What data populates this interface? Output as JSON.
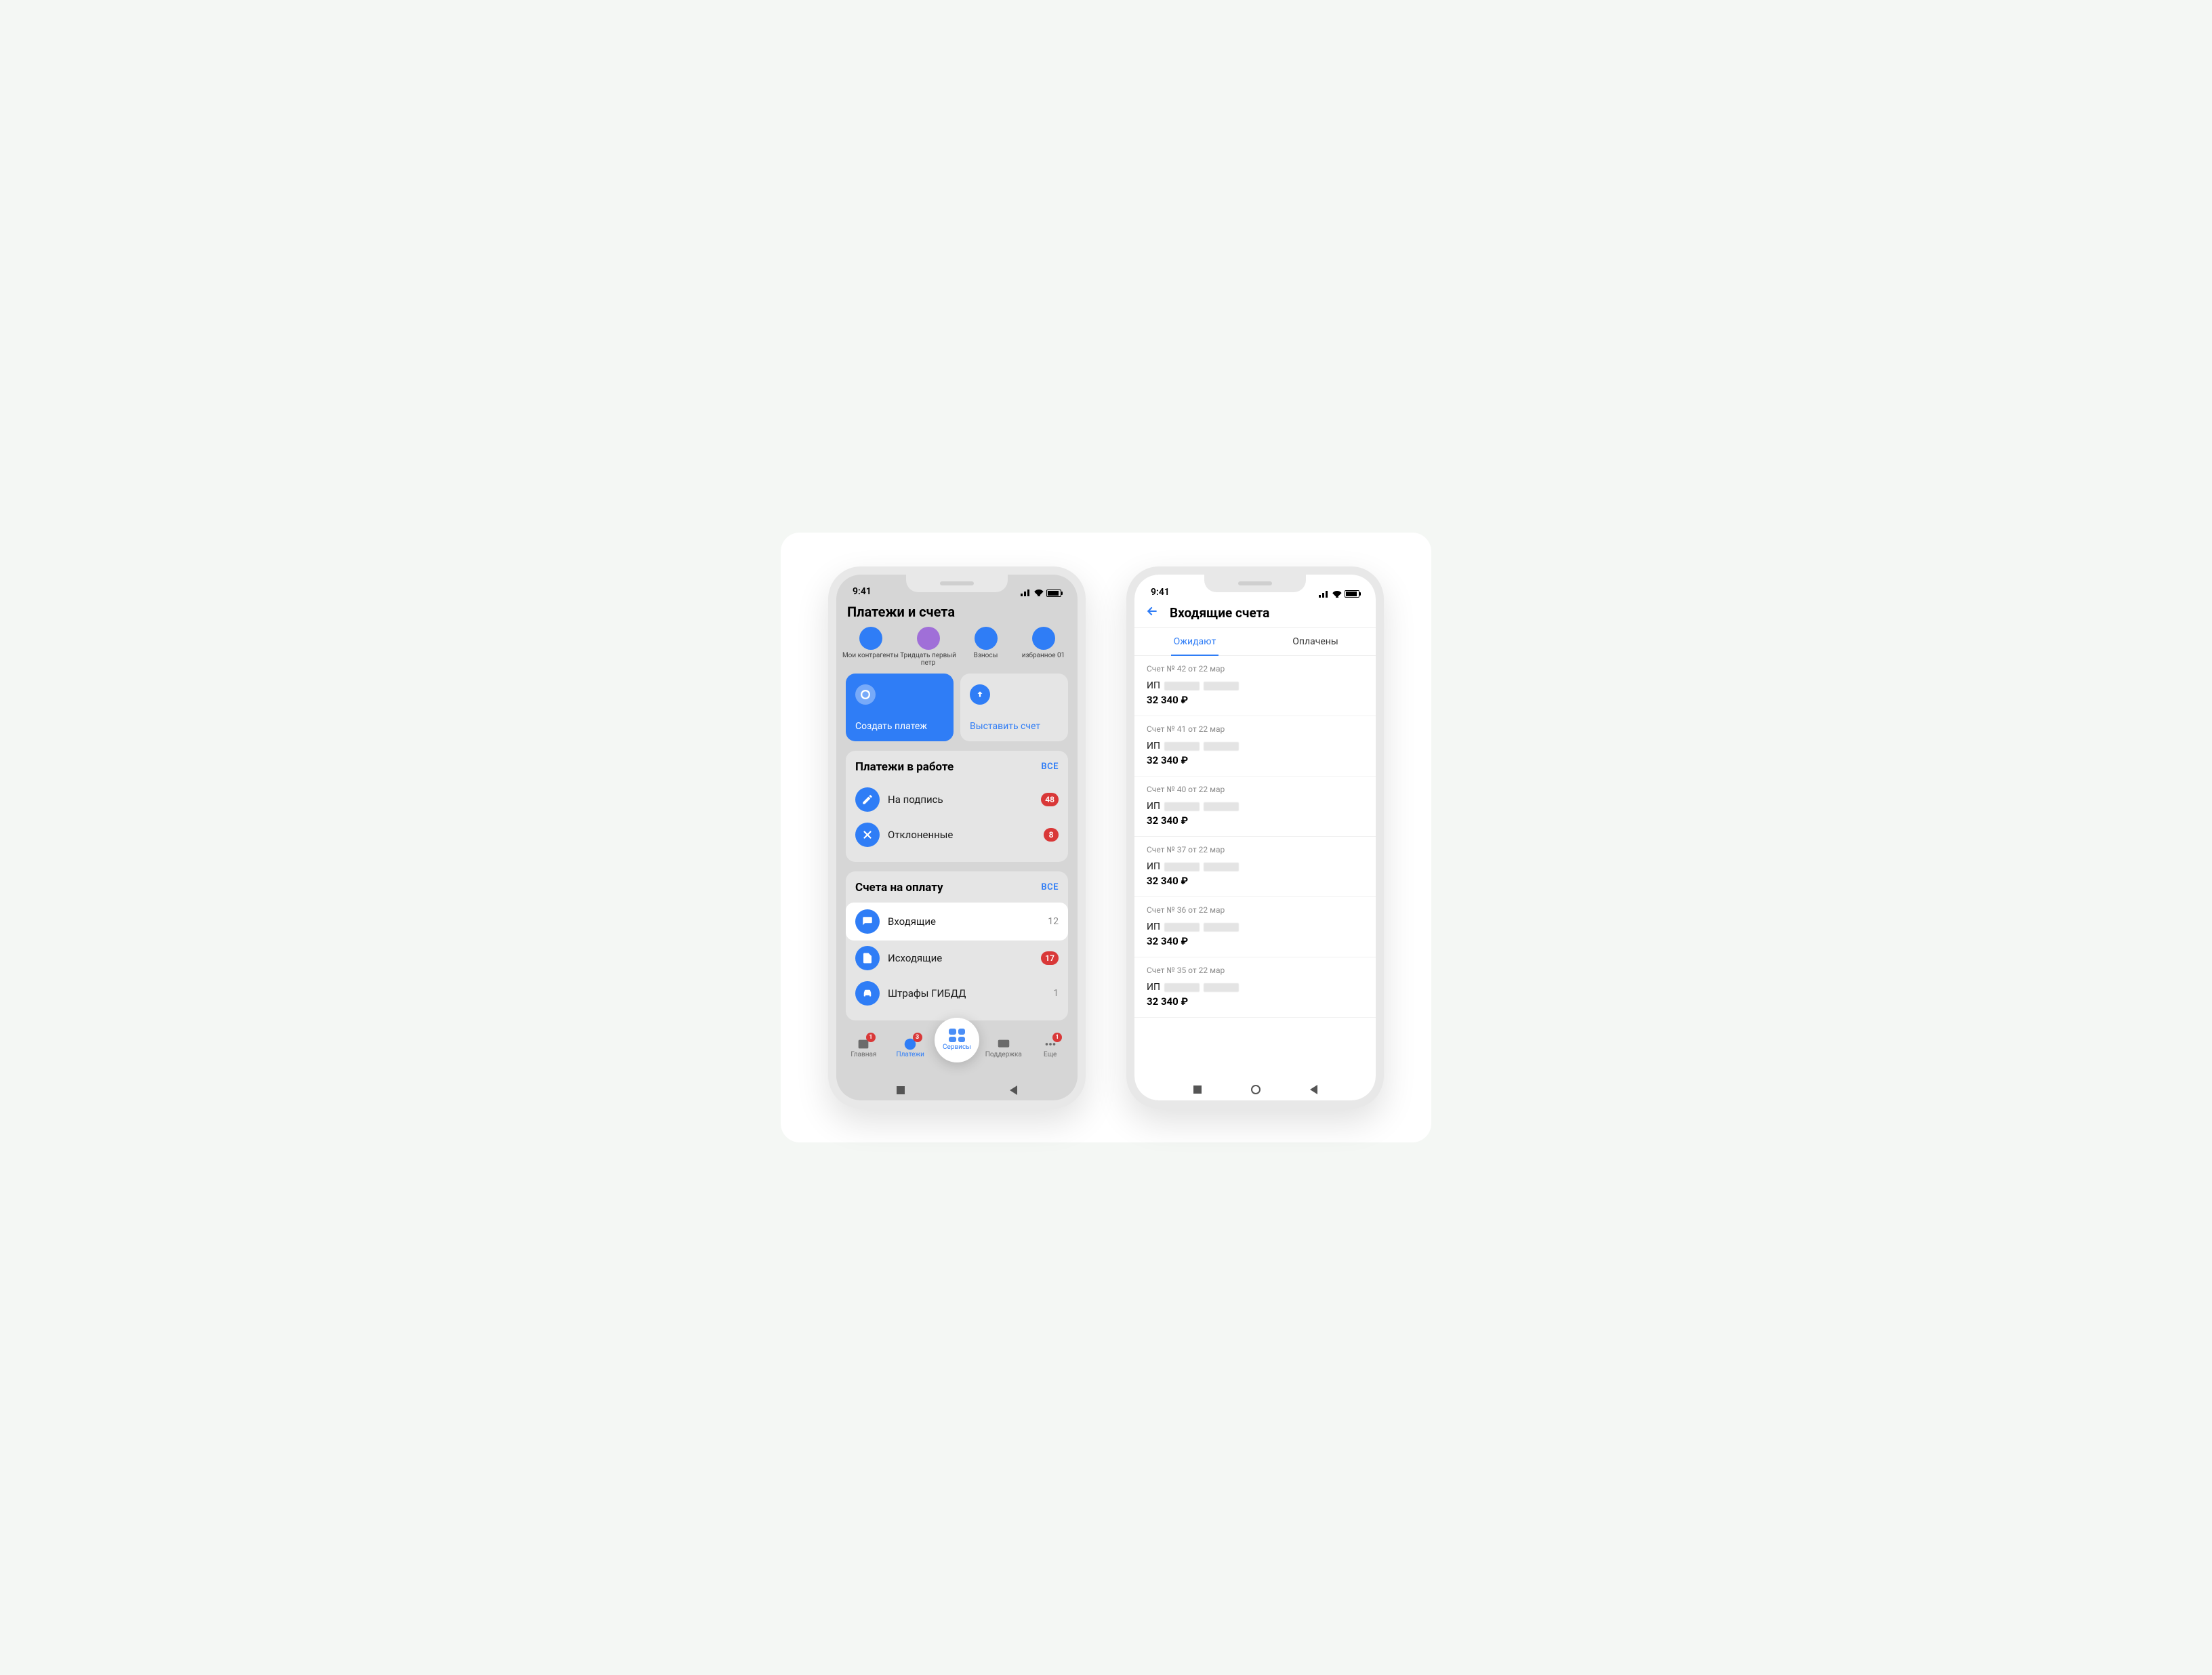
{
  "status": {
    "time": "9:41"
  },
  "phone1": {
    "title": "Платежи и счета",
    "shortcuts": [
      {
        "label": "Мои контрагенты"
      },
      {
        "label": "Тридцать первый петр"
      },
      {
        "label": "Взносы"
      },
      {
        "label": "избранное 01"
      }
    ],
    "actions": {
      "create": "Создать платеж",
      "invoice": "Выставить счет"
    },
    "work": {
      "title": "Платежи в работе",
      "all": "ВСЕ",
      "rows": [
        {
          "label": "На подпись",
          "badge": "48"
        },
        {
          "label": "Отклоненные",
          "badge": "8"
        }
      ]
    },
    "pay": {
      "title": "Счета на оплату",
      "all": "ВСЕ",
      "rows": [
        {
          "label": "Входящие",
          "count": "12"
        },
        {
          "label": "Исходящие",
          "badge": "17"
        },
        {
          "label": "Штрафы ГИБДД",
          "count": "1"
        }
      ]
    },
    "tabs": {
      "home": "Главная",
      "payments": "Платежи",
      "services": "Сервисы",
      "support": "Поддержка",
      "more": "Еще",
      "badges": {
        "home": "1",
        "payments": "3",
        "more": "1"
      }
    }
  },
  "phone2": {
    "title": "Входящие счета",
    "tabs": {
      "pending": "Ожидают",
      "paid": "Оплачены"
    },
    "items": [
      {
        "meta": "Счет № 42 от 22 мар",
        "payer": "ИП",
        "amount": "32 340 ₽"
      },
      {
        "meta": "Счет № 41 от 22 мар",
        "payer": "ИП",
        "amount": "32 340 ₽"
      },
      {
        "meta": "Счет № 40 от 22 мар",
        "payer": "ИП",
        "amount": "32 340 ₽"
      },
      {
        "meta": "Счет № 37 от 22 мар",
        "payer": "ИП",
        "amount": "32 340 ₽"
      },
      {
        "meta": "Счет № 36 от 22 мар",
        "payer": "ИП",
        "amount": "32 340 ₽"
      },
      {
        "meta": "Счет № 35 от 22 мар",
        "payer": "ИП",
        "amount": "32 340 ₽"
      }
    ]
  }
}
